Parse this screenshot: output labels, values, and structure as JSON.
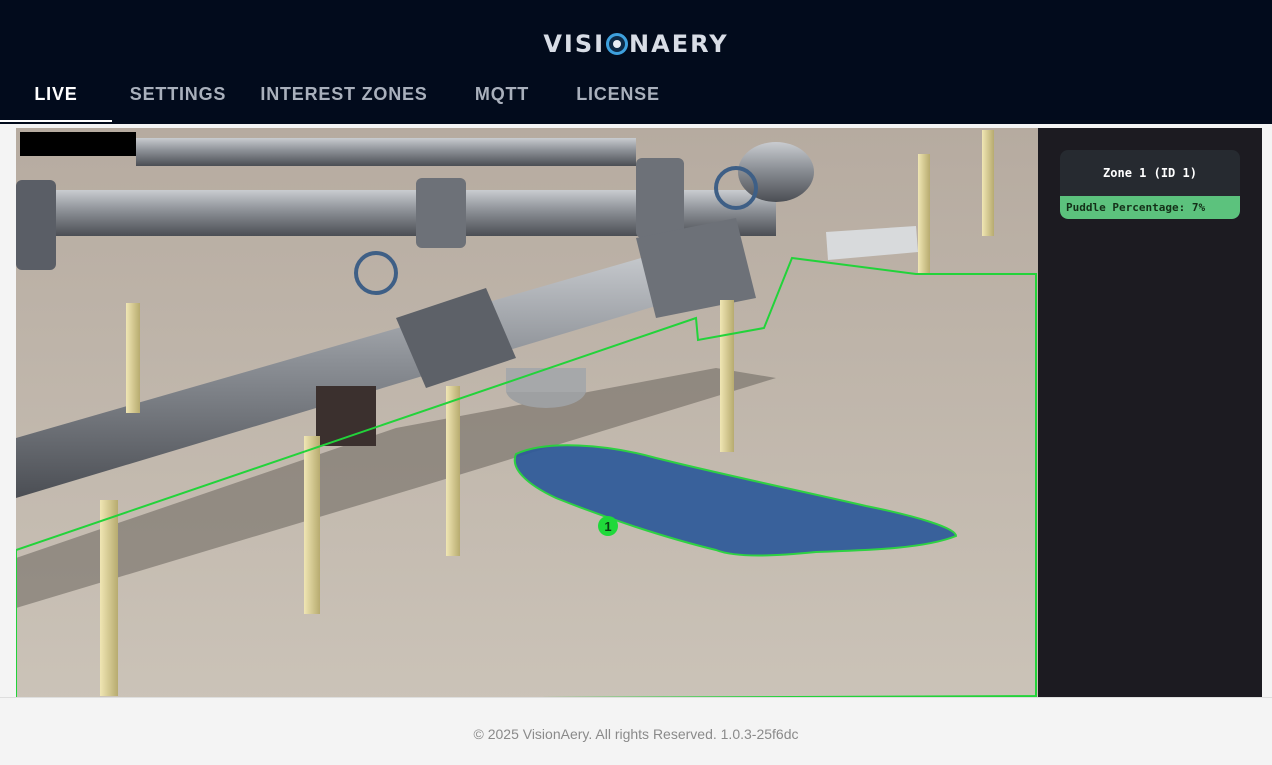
{
  "app": {
    "logo_text_left": "VISI",
    "logo_text_right": "NAERY",
    "logo_icon": "eye-logo-icon"
  },
  "nav": {
    "tabs": [
      {
        "label": "LIVE",
        "active": true
      },
      {
        "label": "SETTINGS",
        "active": false
      },
      {
        "label": "INTEREST ZONES",
        "active": false
      },
      {
        "label": "MQTT",
        "active": false
      },
      {
        "label": "LICENSE",
        "active": false
      }
    ]
  },
  "feed": {
    "puddle_marker_id": "1",
    "zone_outline_color": "#22d33a",
    "puddle_color": "#2e5a9a"
  },
  "zone_panel": {
    "title": "Zone 1 (ID 1)",
    "metric_label": "Puddle Percentage: 7%"
  },
  "footer": {
    "text": "© 2025 VisionAery. All rights Reserved. 1.0.3-25f6dc"
  }
}
